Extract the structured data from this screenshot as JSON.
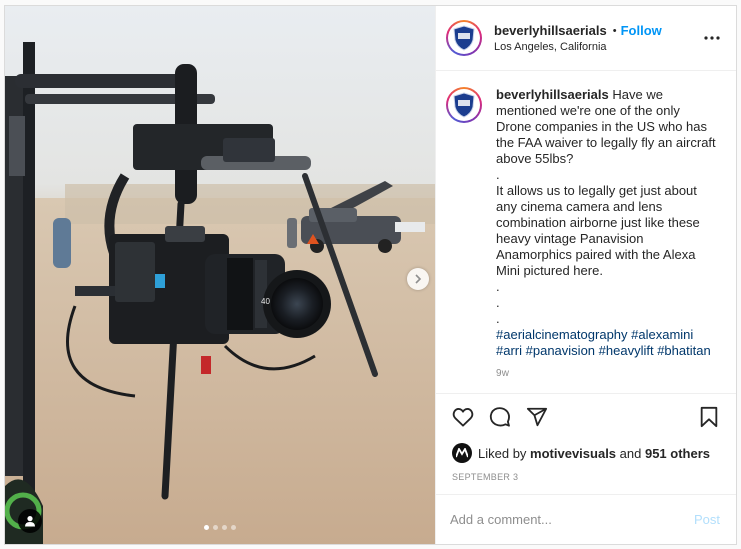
{
  "post": {
    "username": "beverlyhillsaerials",
    "follow_label": "Follow",
    "bullet": "•",
    "location": "Los Angeles, California",
    "more_icon": "more-options-icon",
    "media": {
      "description_icon": "photo",
      "next_icon": "chevron-right-icon",
      "tag_icon": "user-tag-icon",
      "carousel": {
        "count": 4,
        "active_index": 0
      }
    },
    "caption": {
      "username": "beverlyhillsaerials",
      "lines": [
        " Have we",
        "mentioned we're one of the only",
        "Drone companies in the US who has",
        "the FAA waiver to legally fly an aircraft",
        "above 55lbs?",
        ".",
        "It allows us to legally get just about",
        "any cinema camera and lens",
        "combination airborne just like these",
        "heavy vintage Panavision",
        "Anamorphics paired with the Alexa",
        "Mini pictured here.",
        ".",
        ".",
        "."
      ],
      "hashtag_lines": [
        [
          "#aerialcinematography",
          "#alexamini"
        ],
        [
          "#arri",
          "#panavision",
          "#heavylift",
          "#bhatitan"
        ]
      ],
      "time_ago": "9w"
    },
    "actions": {
      "like_icon": "heart-icon",
      "comment_icon": "comment-icon",
      "share_icon": "share-icon",
      "save_icon": "bookmark-icon"
    },
    "likes": {
      "prefix": "Liked by ",
      "liker": "motivevisuals",
      "middle": " and ",
      "count_text": "951 others"
    },
    "date": "SEPTEMBER 3",
    "comment_box": {
      "placeholder": "Add a comment...",
      "post_label": "Post"
    },
    "colors": {
      "follow": "#0095f6",
      "hashtag": "#00376b",
      "post_disabled": "#b2dffc",
      "muted": "#8e8e8e"
    }
  }
}
